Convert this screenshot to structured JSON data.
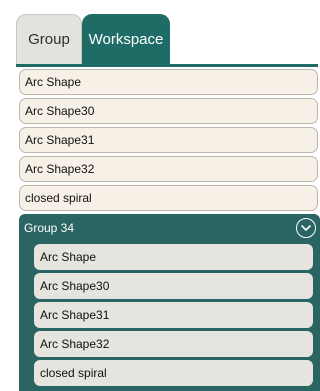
{
  "tabs": {
    "group_label": "Group",
    "workspace_label": "Workspace"
  },
  "items": [
    {
      "label": "Arc Shape"
    },
    {
      "label": "Arc Shape30"
    },
    {
      "label": "Arc Shape31"
    },
    {
      "label": "Arc Shape32"
    },
    {
      "label": "closed spiral"
    }
  ],
  "group": {
    "title": "Group 34",
    "toggle_icon": "chevron-down-icon",
    "items": [
      {
        "label": "Arc Shape"
      },
      {
        "label": "Arc Shape30"
      },
      {
        "label": "Arc Shape31"
      },
      {
        "label": "Arc Shape32"
      },
      {
        "label": "closed spiral"
      }
    ]
  },
  "colors": {
    "accent": "#1f6c67",
    "group_bg": "#2a6563",
    "item_bg": "#f7f0e6",
    "group_item_bg": "#e5e4de"
  }
}
